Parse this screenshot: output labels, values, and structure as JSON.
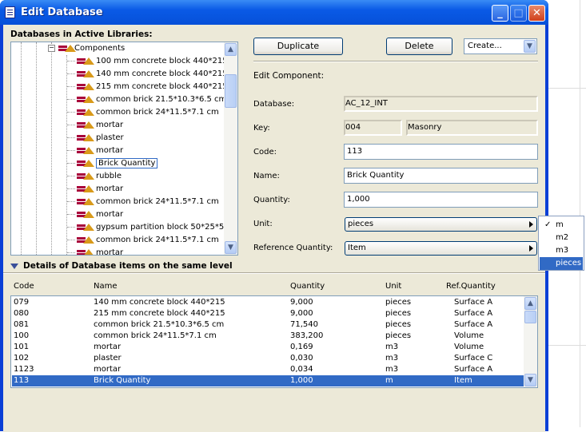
{
  "window": {
    "title": "Edit Database",
    "minimize": "_",
    "maximize": "□",
    "close": "✕"
  },
  "left": {
    "heading": "Databases in Active Libraries:",
    "tree": {
      "folder": "Components",
      "items": [
        "100 mm concrete block 440*215",
        "140 mm concrete block 440*215",
        "215 mm concrete block 440*215",
        "common brick 21.5*10.3*6.5 cm",
        "common brick 24*11.5*7.1 cm",
        "mortar",
        "plaster",
        "mortar",
        "Brick Quantity",
        "rubble",
        "mortar",
        "common brick 24*11.5*7.1 cm",
        "mortar",
        "gypsum partition block 50*25*5",
        "common brick 24*11.5*7.1 cm",
        "mortar"
      ],
      "selected": "Brick Quantity"
    }
  },
  "toolbar": {
    "duplicate": "Duplicate",
    "delete": "Delete",
    "create": "Create..."
  },
  "edit": {
    "heading": "Edit Component:",
    "database_label": "Database:",
    "database": "AC_12_INT",
    "key_label": "Key:",
    "key_code": "004",
    "key_name": "Masonry",
    "code_label": "Code:",
    "code": "113",
    "name_label": "Name:",
    "name": "Brick Quantity",
    "quantity_label": "Quantity:",
    "quantity": "1,000",
    "unit_label": "Unit:",
    "unit": "pieces",
    "ref_label": "Reference Quantity:",
    "ref": "Item"
  },
  "unit_menu": {
    "options": [
      "m",
      "m2",
      "m3",
      "pieces"
    ],
    "checked": "m",
    "highlighted": "pieces",
    "check": "✓"
  },
  "details": {
    "heading": "Details of Database items on the same level",
    "columns": [
      "Code",
      "Name",
      "Quantity",
      "Unit",
      "Ref.Quantity"
    ],
    "rows": [
      [
        "079",
        "140 mm concrete block 440*215",
        "9,000",
        "pieces",
        "Surface A"
      ],
      [
        "080",
        "215 mm concrete block 440*215",
        "9,000",
        "pieces",
        "Surface A"
      ],
      [
        "081",
        "common brick 21.5*10.3*6.5 cm",
        "71,540",
        "pieces",
        "Surface A"
      ],
      [
        "100",
        "common brick 24*11.5*7.1 cm",
        "383,200",
        "pieces",
        "Volume"
      ],
      [
        "101",
        "mortar",
        "0,169",
        "m3",
        "Volume"
      ],
      [
        "102",
        "plaster",
        "0,030",
        "m3",
        "Surface C"
      ],
      [
        "1123",
        "mortar",
        "0,034",
        "m3",
        "Surface A"
      ],
      [
        "113",
        "Brick Quantity",
        "1,000",
        "m",
        "Item"
      ]
    ],
    "selected_row": 7
  },
  "colors": {
    "selection": "#316ac5",
    "dialog": "#ECE9D8",
    "titlebar": "#0a5ae6"
  }
}
